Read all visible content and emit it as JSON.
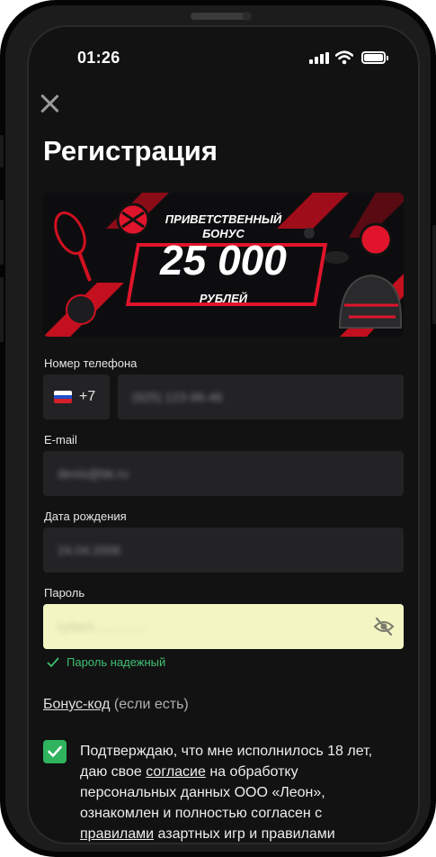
{
  "status": {
    "time": "01:26"
  },
  "page": {
    "title": "Регистрация"
  },
  "banner": {
    "line1": "ПРИВЕТСТВЕННЫЙ",
    "line2": "БОНУС",
    "amount": "25 000",
    "currency": "РУБЛЕЙ"
  },
  "phone_field": {
    "label": "Номер телефона",
    "country_code": "+7",
    "value": "(925) 123-96-46"
  },
  "email_field": {
    "label": "E-mail",
    "value": "denis@bk.ru"
  },
  "birthdate_field": {
    "label": "Дата рождения",
    "value": "24.04.2006"
  },
  "password_field": {
    "label": "Пароль",
    "value": "ryrbert..............."
  },
  "password_strength": {
    "text": "Пароль надежный"
  },
  "bonus_code": {
    "link": "Бонус-код",
    "suffix": " (если есть)"
  },
  "consent": {
    "part1": "Подтверждаю, что мне исполнилось 18 лет, даю свое ",
    "link1": "согласие",
    "part2": " на обработку персональных данных ООО «Леон», ознакомлен и полностью согласен с ",
    "link2": "правилами",
    "part3": " азартных игр и правилами"
  },
  "colors": {
    "accent_red": "#e0142b",
    "success_green": "#2fb35e",
    "password_bg": "#f3f6c2"
  },
  "icons": [
    "close-icon",
    "signal-icon",
    "wifi-icon",
    "battery-icon",
    "russia-flag-icon",
    "eye-off-icon",
    "check-icon"
  ]
}
